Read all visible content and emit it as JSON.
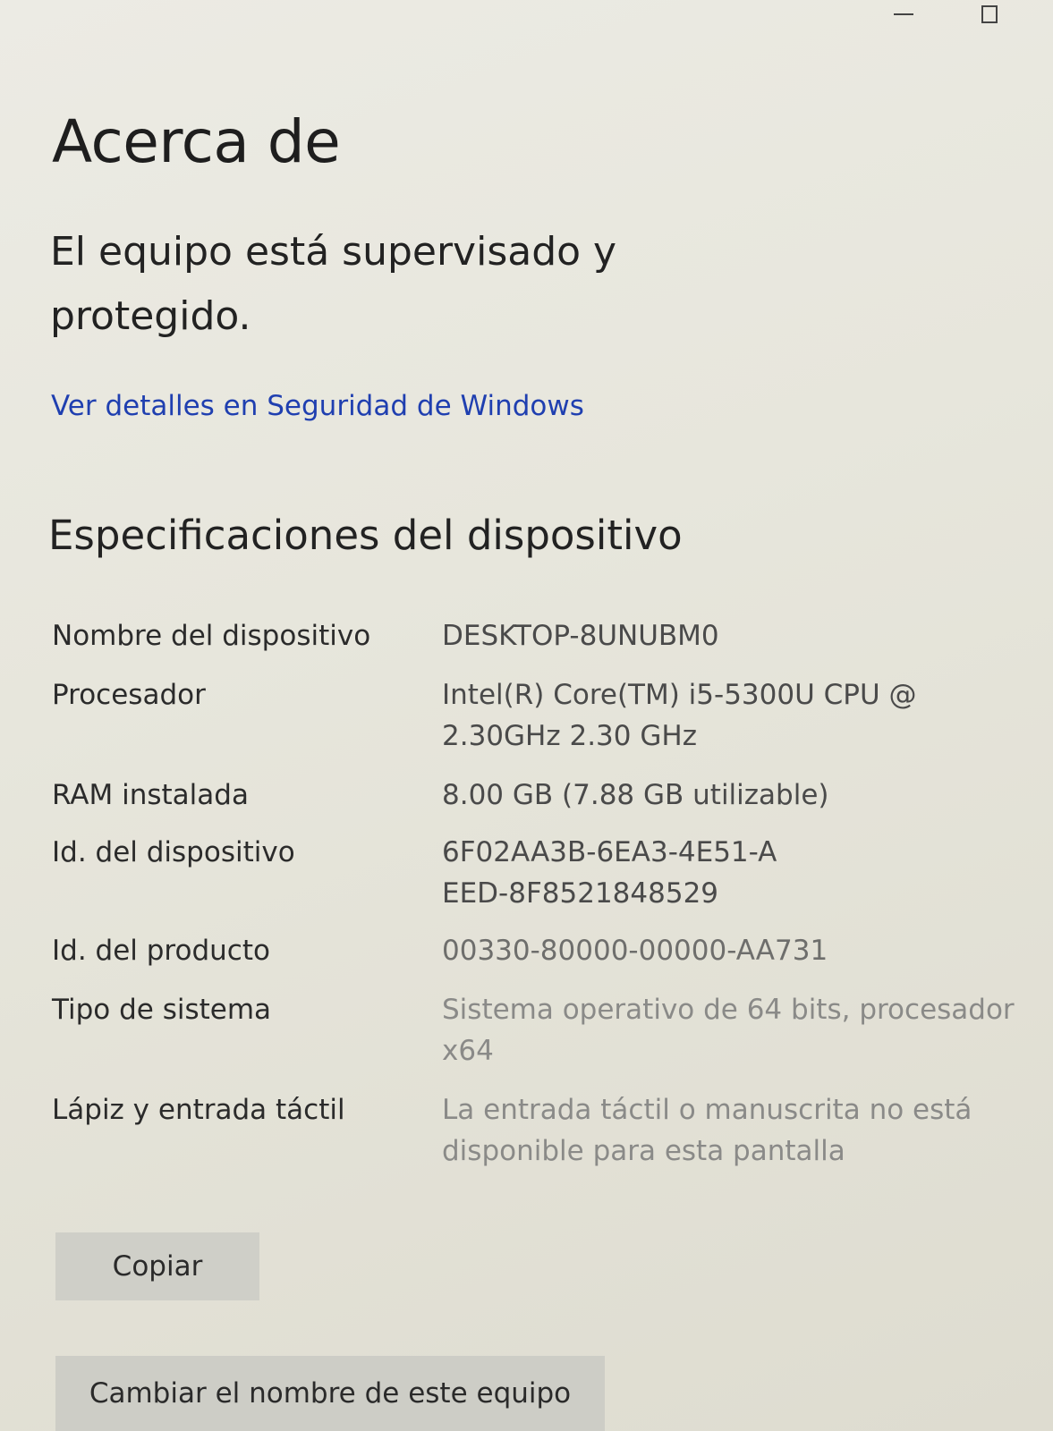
{
  "window_controls": {
    "minimize_icon": "minimize-icon",
    "maximize_icon": "maximize-icon"
  },
  "header": {
    "title": "Acerca de"
  },
  "security": {
    "status": "El equipo está supervisado y protegido.",
    "link_text": "Ver detalles en Seguridad de Windows",
    "link_color": "#1f3fb0"
  },
  "specs": {
    "section_title": "Especificaciones del dispositivo",
    "rows": [
      {
        "label": "Nombre del dispositivo",
        "value": "DESKTOP-8UNUBM0"
      },
      {
        "label": "Procesador",
        "value": "Intel(R) Core(TM) i5-5300U CPU @ 2.30GHz   2.30 GHz"
      },
      {
        "label": "RAM instalada",
        "value": "8.00 GB (7.88 GB utilizable)"
      },
      {
        "label": "Id. del dispositivo",
        "value": "6F02AA3B-6EA3-4E51-AEED-8F8521848529"
      },
      {
        "label": "Id. del producto",
        "value": "00330-80000-00000-AA731"
      },
      {
        "label": "Tipo de sistema",
        "value": "Sistema operativo de 64 bits, procesador x64"
      },
      {
        "label": "Lápiz y entrada táctil",
        "value": "La entrada táctil o manuscrita no está disponible para esta pantalla"
      }
    ]
  },
  "actions": {
    "copy_label": "Copiar",
    "rename_label": "Cambiar el nombre de este equipo"
  }
}
